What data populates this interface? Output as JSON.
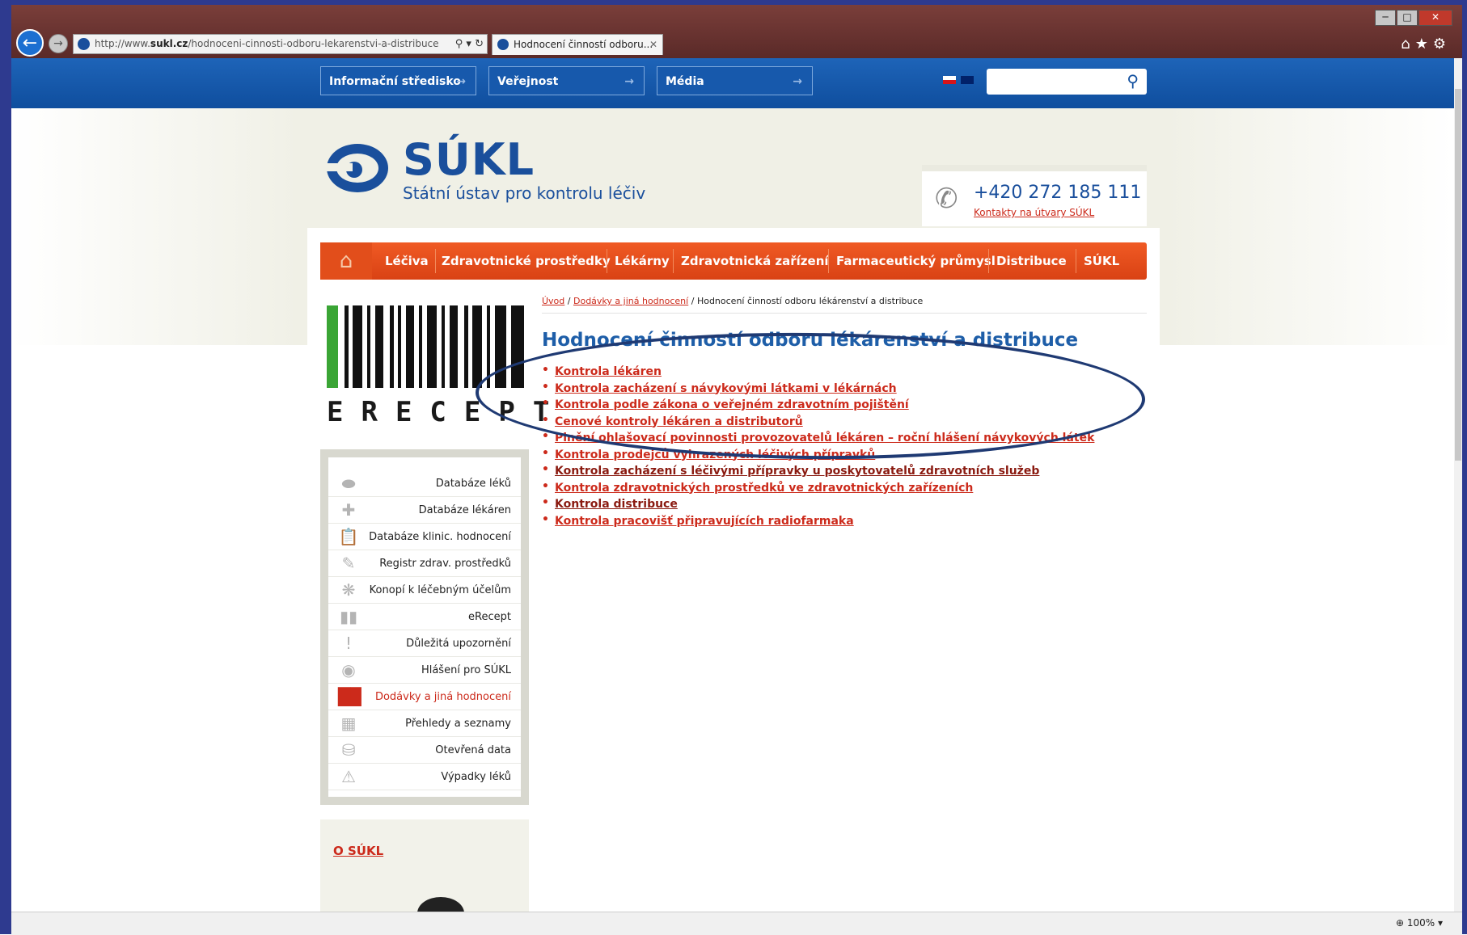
{
  "browser": {
    "url_prefix": "http://www.",
    "url_domain": "sukl.cz",
    "url_path": "/hodnoceni-cinnosti-odboru-lekarenstvi-a-distribuce",
    "tab_title": "Hodnocení činností odboru...",
    "zoom": "100%"
  },
  "topnav": {
    "items": [
      "Informační středisko",
      "Veřejnost",
      "Média"
    ],
    "arrow": "→",
    "search_placeholder": ""
  },
  "logo": {
    "name": "SÚKL",
    "subtitle": "Státní ústav pro kontrolu léčiv"
  },
  "contact": {
    "phone": "+420 272 185 111",
    "link": "Kontakty na útvary SÚKL"
  },
  "mainnav": {
    "items": [
      "Léčiva",
      "Zdravotnické prostředky",
      "Lékárny",
      "Zdravotnická zařízení",
      "Farmaceutický průmysl",
      "Distribuce",
      "SÚKL"
    ]
  },
  "erecept": {
    "label": "ERECEPT"
  },
  "sidebar": {
    "items": [
      {
        "label": "Databáze léků",
        "icon": "pill-icon"
      },
      {
        "label": "Databáze lékáren",
        "icon": "cross-icon"
      },
      {
        "label": "Databáze klinic. hodnocení",
        "icon": "clipboard-icon"
      },
      {
        "label": "Registr zdrav. prostředků",
        "icon": "tool-icon"
      },
      {
        "label": "Konopí k léčebným účelům",
        "icon": "cannabis-icon"
      },
      {
        "label": "eRecept",
        "icon": "barcode-icon"
      },
      {
        "label": "Důležitá upozornění",
        "icon": "exclamation-icon"
      },
      {
        "label": "Hlášení pro SÚKL",
        "icon": "speech-bubble-icon"
      },
      {
        "label": "Dodávky a jiná hodnocení",
        "icon": "bar-chart-icon"
      },
      {
        "label": "Přehledy a seznamy",
        "icon": "grid-icon"
      },
      {
        "label": "Otevřená data",
        "icon": "database-icon"
      },
      {
        "label": "Výpadky léků",
        "icon": "warning-icon"
      }
    ]
  },
  "about": {
    "link": "O SÚKL"
  },
  "breadcrumb": {
    "home": "Úvod",
    "sep": "/",
    "parent": "Dodávky a jiná hodnocení",
    "current": "Hodnocení činností odboru lékárenství a distribuce"
  },
  "page": {
    "title": "Hodnocení činností odboru lékárenství a distribuce",
    "links": [
      "Kontrola lékáren",
      "Kontrola zacházení s návykovými látkami v lékárnách",
      "Kontrola podle zákona o veřejném zdravotním pojištění",
      "Cenové kontroly lékáren a distributorů",
      "Plnění ohlašovací povinnosti provozovatelů lékáren – roční hlášení návykových látek",
      "Kontrola prodejců vyhrazených léčivých přípravků",
      "Kontrola zacházení s léčivými přípravky u poskytovatelů zdravotních služeb",
      "Kontrola zdravotnických prostředků ve zdravotnických zařízeních",
      "Kontrola distribuce",
      "Kontrola pracovišť připravujících radiofarmaka"
    ]
  },
  "colors": {
    "brand_blue": "#1a4f9c",
    "nav_orange": "#e24e1b",
    "link_red": "#cc2a1b",
    "annotation_oval": "#1f3a73"
  }
}
